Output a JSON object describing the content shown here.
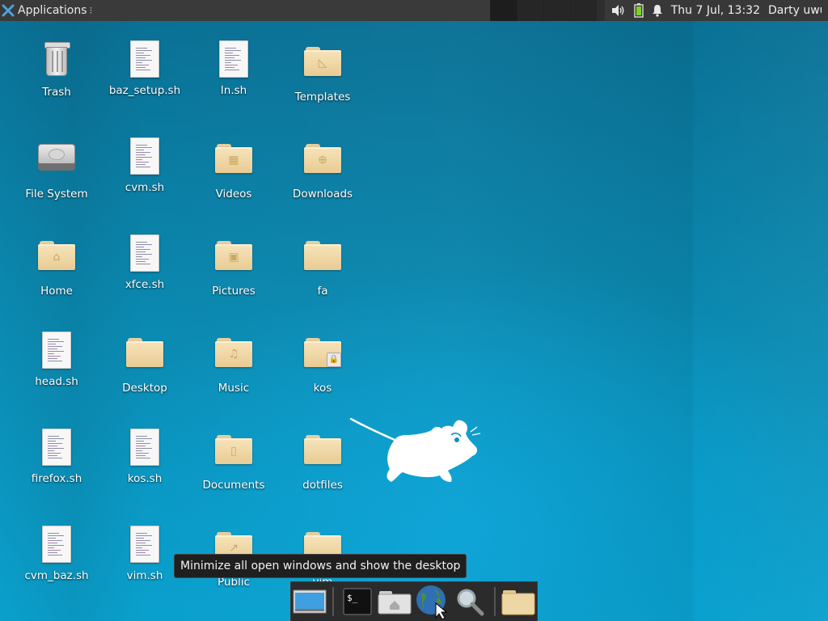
{
  "top_panel": {
    "applications_label": "Applications",
    "menu_glyph": "⁝",
    "clock": "Thu  7 Jul, 13:32",
    "user": "Darty uwu",
    "icons": [
      "xfce-logo-icon",
      "volume-icon",
      "battery-icon",
      "bell-icon"
    ]
  },
  "desktop": {
    "icons": [
      {
        "label": "Trash",
        "kind": "trash"
      },
      {
        "label": "baz_setup.sh",
        "kind": "file"
      },
      {
        "label": "In.sh",
        "kind": "file"
      },
      {
        "label": "Templates",
        "kind": "folder-templates"
      },
      {
        "label": "File System",
        "kind": "drive"
      },
      {
        "label": "cvm.sh",
        "kind": "file"
      },
      {
        "label": "Videos",
        "kind": "folder-videos"
      },
      {
        "label": "Downloads",
        "kind": "folder-downloads"
      },
      {
        "label": "Home",
        "kind": "folder-home"
      },
      {
        "label": "xfce.sh",
        "kind": "file"
      },
      {
        "label": "Pictures",
        "kind": "folder-pictures"
      },
      {
        "label": "fa",
        "kind": "folder"
      },
      {
        "label": "head.sh",
        "kind": "file"
      },
      {
        "label": "Desktop",
        "kind": "folder"
      },
      {
        "label": "Music",
        "kind": "folder-music"
      },
      {
        "label": "kos",
        "kind": "folder-locked"
      },
      {
        "label": "firefox.sh",
        "kind": "file"
      },
      {
        "label": "kos.sh",
        "kind": "file"
      },
      {
        "label": "Documents",
        "kind": "folder-documents"
      },
      {
        "label": "dotfiles",
        "kind": "folder"
      },
      {
        "label": "cvm_baz.sh",
        "kind": "file"
      },
      {
        "label": "vim.sh",
        "kind": "file"
      },
      {
        "label": "Public",
        "kind": "folder-public"
      },
      {
        "label": "vim",
        "kind": "folder"
      }
    ]
  },
  "tooltip": "Minimize all open windows and show the desktop",
  "dock": {
    "items": [
      "show-desktop-icon",
      "terminal-icon",
      "home-folder-icon",
      "web-browser-icon",
      "search-icon",
      "folder-icon"
    ],
    "terminal_prompt": "$_"
  }
}
